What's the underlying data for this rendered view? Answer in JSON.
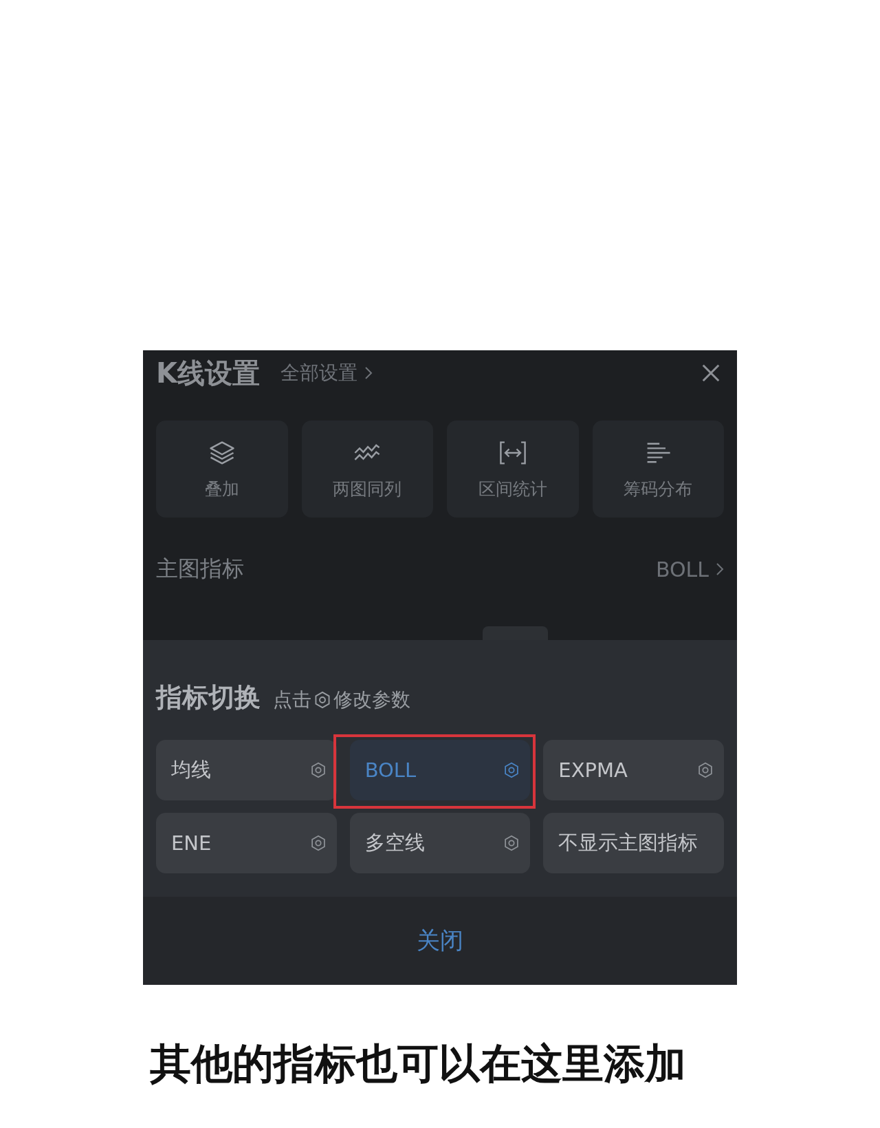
{
  "header": {
    "title": "K线设置",
    "link": "全部设置"
  },
  "tools": [
    {
      "kind": "layers",
      "label": "叠加"
    },
    {
      "kind": "waves",
      "label": "两图同列"
    },
    {
      "kind": "range",
      "label": "区间统计"
    },
    {
      "kind": "bars",
      "label": "筹码分布"
    }
  ],
  "main_indicator": {
    "label": "主图指标",
    "value": "BOLL"
  },
  "sheet": {
    "title": "指标切换",
    "hint_before": "点击",
    "hint_after": "修改参数",
    "options": [
      {
        "label": "均线",
        "settings": true,
        "selected": false
      },
      {
        "label": "BOLL",
        "settings": true,
        "selected": true
      },
      {
        "label": "EXPMA",
        "settings": true,
        "selected": false
      },
      {
        "label": "ENE",
        "settings": true,
        "selected": false
      },
      {
        "label": "多空线",
        "settings": true,
        "selected": false
      },
      {
        "label": "不显示主图指标",
        "settings": false,
        "selected": false
      }
    ],
    "close": "关闭"
  },
  "caption": "其他的指标也可以在这里添加"
}
